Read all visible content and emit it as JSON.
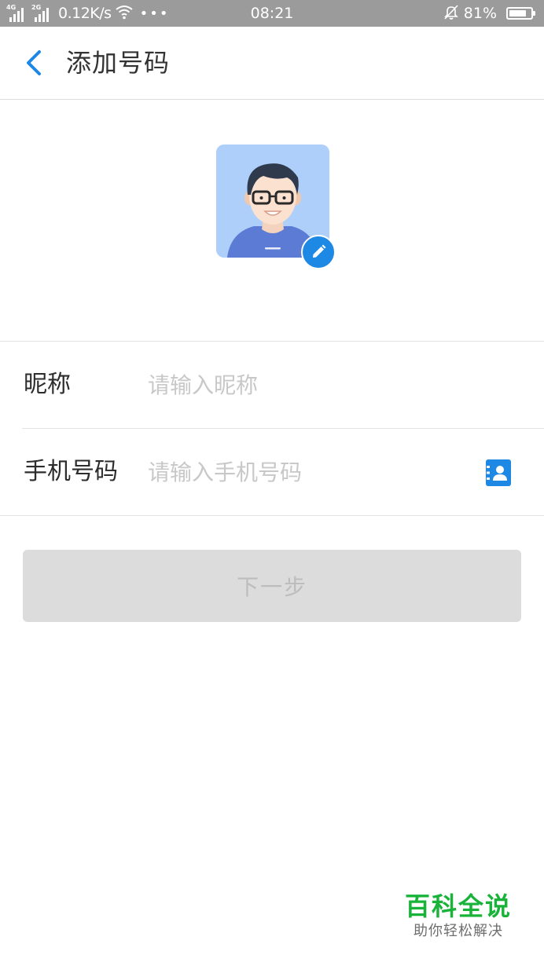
{
  "status_bar": {
    "signal1_label": "4G",
    "signal2_label": "2G",
    "speed": "0.12K/s",
    "more": "•••",
    "time": "08:21",
    "battery": "81%",
    "battery_level": 0.81
  },
  "header": {
    "title": "添加号码",
    "back_icon": "chevron-left-icon"
  },
  "avatar": {
    "edit_icon": "pencil-icon",
    "background_color": "#aecff9"
  },
  "form": {
    "nickname": {
      "label": "昵称",
      "placeholder": "请输入昵称",
      "value": ""
    },
    "phone": {
      "label": "手机号码",
      "placeholder": "请输入手机号码",
      "value": "",
      "contacts_icon": "contacts-icon"
    }
  },
  "next_button": {
    "label": "下一步",
    "enabled": false
  },
  "watermark": {
    "title": "百科全说",
    "subtitle": "助你轻松解决"
  },
  "colors": {
    "accent": "#1e88e5",
    "status_bar": "#9b9b9b",
    "disabled_button": "#dcdcdc",
    "watermark_green": "#19b33a"
  }
}
